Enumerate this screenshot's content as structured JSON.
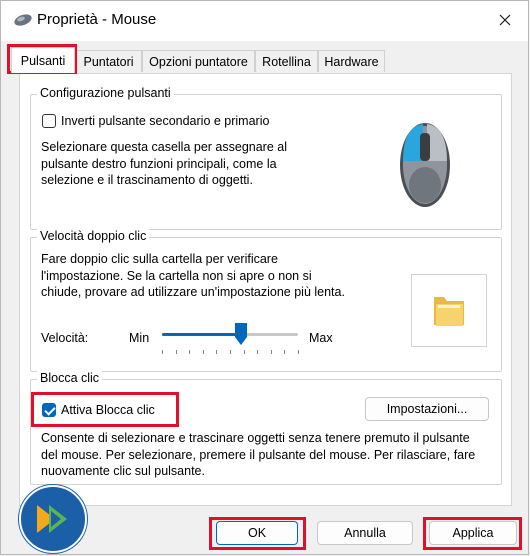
{
  "window": {
    "title": "Proprietà - Mouse"
  },
  "tabs": [
    {
      "label": "Pulsanti"
    },
    {
      "label": "Puntatori"
    },
    {
      "label": "Opzioni puntatore"
    },
    {
      "label": "Rotellina"
    },
    {
      "label": "Hardware"
    }
  ],
  "button_config": {
    "title": "Configurazione pulsanti",
    "swap_label": "Inverti pulsante secondario e primario",
    "swap_checked": false,
    "description": "Selezionare questa casella per assegnare al pulsante destro funzioni principali, come la selezione e il trascinamento di oggetti."
  },
  "double_click": {
    "title": "Velocità doppio clic",
    "description": "Fare doppio clic sulla cartella per verificare l'impostazione. Se la cartella non si apre o non si chiude, provare ad utilizzare un'impostazione più lenta.",
    "speed_label": "Velocità:",
    "min_label": "Min",
    "max_label": "Max",
    "speed_value": 0.58
  },
  "click_lock": {
    "title": "Blocca clic",
    "checkbox_label": "Attiva Blocca clic",
    "checked": true,
    "settings_button": "Impostazioni...",
    "description": "Consente di selezionare e trascinare oggetti senza tenere premuto il pulsante del mouse. Per selezionare, premere il pulsante del mouse. Per rilasciare, fare nuovamente clic sul pulsante."
  },
  "footer": {
    "ok": "OK",
    "cancel": "Annulla",
    "apply": "Applica"
  },
  "colors": {
    "accent": "#0067c0",
    "highlight": "#e0102a"
  }
}
